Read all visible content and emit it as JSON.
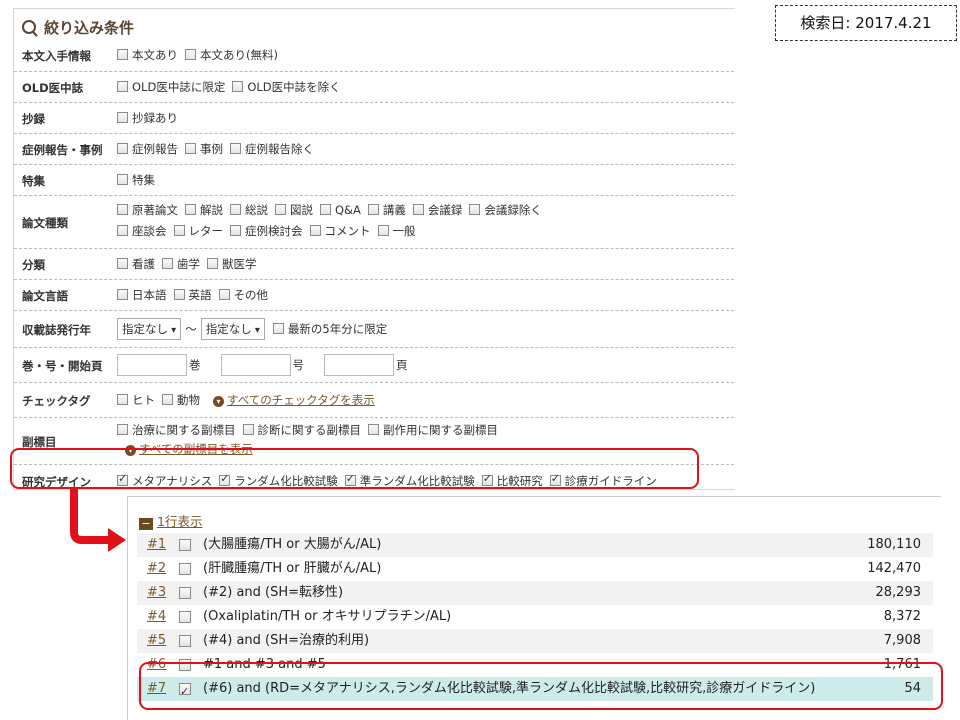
{
  "date_note": "検索日: 2017.4.21",
  "filter": {
    "title": "絞り込み条件",
    "rows": [
      {
        "label": "本文入手情報",
        "options": [
          "本文あり",
          "本文あり(無料)"
        ]
      },
      {
        "label": "OLD医中誌",
        "options": [
          "OLD医中誌に限定",
          "OLD医中誌を除く"
        ]
      },
      {
        "label": "抄録",
        "options": [
          "抄録あり"
        ]
      },
      {
        "label": "症例報告・事例",
        "options": [
          "症例報告",
          "事例",
          "症例報告除く"
        ]
      },
      {
        "label": "特集",
        "options": [
          "特集"
        ]
      },
      {
        "label": "論文種類",
        "options_line1": [
          "原著論文",
          "解説",
          "総説",
          "図説",
          "Q&A",
          "講義",
          "会議録",
          "会議録除く"
        ],
        "options_line2": [
          "座談会",
          "レター",
          "症例検討会",
          "コメント",
          "一般"
        ]
      },
      {
        "label": "分類",
        "options": [
          "看護",
          "歯学",
          "獣医学"
        ]
      },
      {
        "label": "論文言語",
        "options": [
          "日本語",
          "英語",
          "その他"
        ]
      },
      {
        "label": "収載誌発行年",
        "from_select": "指定なし",
        "tilde": "〜",
        "to_select": "指定なし",
        "latest": "最新の5年分に限定"
      },
      {
        "label": "巻・号・開始頁",
        "vol": "巻",
        "issue": "号",
        "page": "頁"
      },
      {
        "label": "チェックタグ",
        "options": [
          "ヒト",
          "動物"
        ],
        "show_all": "すべてのチェックタグを表示"
      },
      {
        "label": "副標目",
        "options": [
          "治療に関する副標目",
          "診断に関する副標目",
          "副作用に関する副標目"
        ],
        "show_all": "すべての副標目を表示"
      },
      {
        "label": "研究デザイン",
        "options": [
          "メタアナリシス",
          "ランダム化比較試験",
          "準ランダム化比較試験",
          "比較研究",
          "診療ガイドライン"
        ],
        "checked": true
      }
    ]
  },
  "history": {
    "toggle_label": "1行表示",
    "rows": [
      {
        "num": "#1",
        "query": "(大腸腫瘍/TH or 大腸がん/AL)",
        "count": "180,110",
        "checked": false
      },
      {
        "num": "#2",
        "query": "(肝臓腫瘍/TH or 肝臓がん/AL)",
        "count": "142,470",
        "checked": false
      },
      {
        "num": "#3",
        "query": "(#2) and (SH=転移性)",
        "count": "28,293",
        "checked": false
      },
      {
        "num": "#4",
        "query": "(Oxaliplatin/TH or オキサリプラチン/AL)",
        "count": "8,372",
        "checked": false
      },
      {
        "num": "#5",
        "query": "(#4) and (SH=治療的利用)",
        "count": "7,908",
        "checked": false
      },
      {
        "num": "#6",
        "query": "#1 and #3 and #5",
        "count": "1,761",
        "checked": false
      },
      {
        "num": "#7",
        "query": "(#6) and (RD=メタアナリシス,ランダム化比較試験,準ランダム化比較試験,比較研究,診療ガイドライン)",
        "count": "54",
        "checked": true
      }
    ]
  },
  "colors": {
    "highlight": "#e0111b",
    "link": "#7b5a2a",
    "selected_row": "#cdebeb"
  }
}
